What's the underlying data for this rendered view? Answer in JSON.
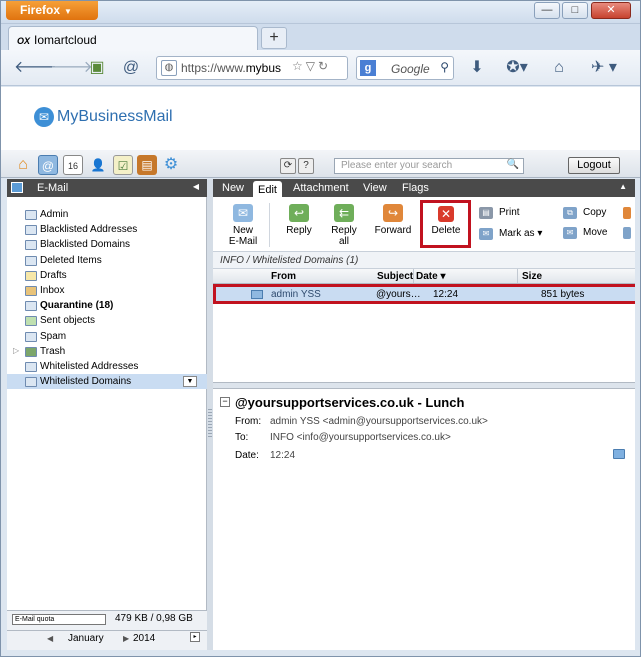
{
  "browser": {
    "app_button": "Firefox",
    "tab_title": "Iomartcloud",
    "tab_icon": "OX",
    "url_prefix": "https://www.",
    "url_host": "mybus",
    "search_placeholder": "Google",
    "win_min": "—",
    "win_max": "□",
    "win_close": "✕",
    "new_tab": "+"
  },
  "brand": {
    "logo_text": "MyBusinessMail"
  },
  "app": {
    "search_placeholder": "Please enter your search",
    "logout_label": "Logout",
    "refresh_glyph": "⟳",
    "help_glyph": "?"
  },
  "sidebar": {
    "title": "E-Mail",
    "folders": [
      {
        "label": "Admin"
      },
      {
        "label": "Blacklisted Addresses"
      },
      {
        "label": "Blacklisted Domains"
      },
      {
        "label": "Deleted Items"
      },
      {
        "label": "Drafts"
      },
      {
        "label": "Inbox"
      },
      {
        "label": "Quarantine (18)"
      },
      {
        "label": "Sent objects"
      },
      {
        "label": "Spam"
      },
      {
        "label": "Trash"
      },
      {
        "label": "Whitelisted Addresses"
      },
      {
        "label": "Whitelisted Domains"
      }
    ],
    "quota_label": "E-Mail quota",
    "quota_value": "479 KB / 0,98 GB",
    "cal_month": "January",
    "cal_year": "2014"
  },
  "ribbon": {
    "tabs": [
      "New",
      "Edit",
      "Attachment",
      "View",
      "Flags"
    ],
    "active_tab": "Edit",
    "buttons": {
      "new_email_1": "New",
      "new_email_2": "E-Mail",
      "reply": "Reply",
      "reply_all_1": "Reply",
      "reply_all_2": "all",
      "forward": "Forward",
      "delete": "Delete",
      "print": "Print",
      "mark_as": "Mark as ▾",
      "copy": "Copy",
      "move": "Move"
    }
  },
  "list": {
    "breadcrumb": "INFO / Whitelisted Domains (1)",
    "columns": {
      "from": "From",
      "subject": "Subject",
      "date": "Date ▾",
      "size": "Size"
    },
    "rows": [
      {
        "from": "admin YSS",
        "subject": "@yoursupportservices.co.uk - Lunch",
        "date": "12:24",
        "size": "851 bytes"
      }
    ]
  },
  "preview": {
    "toggle": "−",
    "subject": "@yoursupportservices.co.uk - Lunch",
    "from_label": "From:",
    "from_value": "admin YSS <admin@yoursupportservices.co.uk>",
    "to_label": "To:",
    "to_value": "INFO <info@yoursupportservices.co.uk>",
    "date_label": "Date:",
    "date_value": "12:24"
  },
  "colors": {
    "highlight_red": "#c1121f",
    "selection": "#c9dcf2",
    "brand_blue": "#2e6fb0",
    "dark_bar": "#4a4a4a"
  }
}
